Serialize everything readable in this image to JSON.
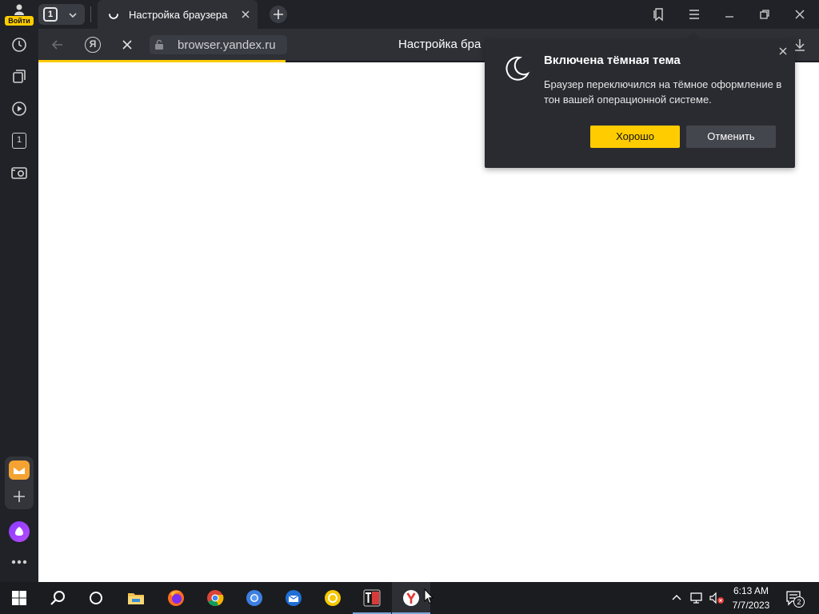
{
  "browser": {
    "profile": {
      "signin_label": "Войти"
    },
    "tab_switcher": {
      "count": "1"
    },
    "active_tab": {
      "title": "Настройка браузера"
    },
    "addressbar": {
      "ya_label": "Я",
      "url": "browser.yandex.ru",
      "page_title": "Настройка бра"
    },
    "accent_color": "#ffcc00"
  },
  "sidebar": {
    "items": [
      {
        "name": "history-icon"
      },
      {
        "name": "collections-icon"
      },
      {
        "name": "video-icon"
      },
      {
        "name": "tab-count-icon",
        "label": "1"
      },
      {
        "name": "screenshot-icon"
      }
    ]
  },
  "popup": {
    "title": "Включена тёмная тема",
    "text": "Браузер переключился на тёмное оформление в тон вашей операционной системе.",
    "ok_label": "Хорошо",
    "cancel_label": "Отменить"
  },
  "taskbar": {
    "apps": [
      "start",
      "search",
      "cortana",
      "file-explorer",
      "firefox",
      "chrome",
      "chromium",
      "thunderbird",
      "yandex-alt",
      "typora",
      "yandex-browser"
    ],
    "clock": {
      "time": "6:13 AM",
      "date": "7/7/2023"
    },
    "notifications_count": "2"
  }
}
